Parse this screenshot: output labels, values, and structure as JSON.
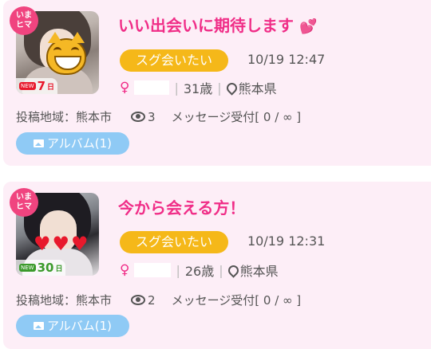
{
  "posts": [
    {
      "imahima_badge": "いま\nヒマ",
      "new_tag": "NEW",
      "days_num": "7",
      "days_unit": "日",
      "title": "いい出会いに期待します",
      "title_icon": "heart-icon",
      "status": "スグ会いたい",
      "timestamp": "10/19 12:47",
      "gender_symbol": "♀",
      "age": "31歳",
      "prefecture": "熊本県",
      "area_label": "投稿地域：熊本市",
      "views": "3",
      "message_label": "メッセージ受付[ 0 / ∞ ]",
      "album_label": "アルバム(1)"
    },
    {
      "imahima_badge": "いま\nヒマ",
      "new_tag": "NEW",
      "days_num": "30",
      "days_unit": "日",
      "title": "今から会える方！",
      "status": "スグ会いたい",
      "timestamp": "10/19 12:31",
      "gender_symbol": "♀",
      "age": "26歳",
      "prefecture": "熊本県",
      "area_label": "投稿地域：熊本市",
      "views": "2",
      "message_label": "メッセージ受付[ 0 / ∞ ]",
      "album_label": "アルバム(1)"
    }
  ],
  "colors": {
    "card_bg": "#fdeef7",
    "title_pink": "#f02d87",
    "status_yellow": "#f5b819",
    "album_blue": "#8fcaf5"
  }
}
